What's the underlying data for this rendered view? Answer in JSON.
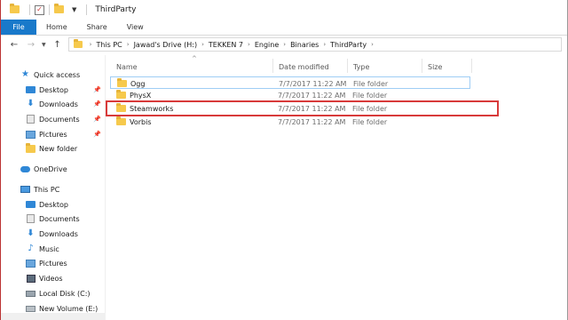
{
  "window": {
    "title": "ThirdParty"
  },
  "ribbon": {
    "tabs": [
      "File",
      "Home",
      "Share",
      "View"
    ]
  },
  "address": {
    "crumbs": [
      "This PC",
      "Jawad's Drive (H:)",
      "TEKKEN 7",
      "Engine",
      "Binaries",
      "ThirdParty"
    ]
  },
  "columns": {
    "name": "Name",
    "date": "Date modified",
    "type": "Type",
    "size": "Size"
  },
  "files": [
    {
      "name": "Ogg",
      "date": "7/7/2017 11:22 AM",
      "type": "File folder",
      "size": ""
    },
    {
      "name": "PhysX",
      "date": "7/7/2017 11:22 AM",
      "type": "File folder",
      "size": ""
    },
    {
      "name": "Steamworks",
      "date": "7/7/2017 11:22 AM",
      "type": "File folder",
      "size": ""
    },
    {
      "name": "Vorbis",
      "date": "7/7/2017 11:22 AM",
      "type": "File folder",
      "size": ""
    }
  ],
  "nav": {
    "quick_access": "Quick access",
    "quick_items": [
      "Desktop",
      "Downloads",
      "Documents",
      "Pictures",
      "New folder"
    ],
    "onedrive": "OneDrive",
    "this_pc": "This PC",
    "pc_items": [
      "Desktop",
      "Documents",
      "Downloads",
      "Music",
      "Pictures",
      "Videos",
      "Local Disk (C:)",
      "New Volume (E:)"
    ]
  },
  "colors": {
    "accent": "#1979ca",
    "highlight_box": "#d83a3a",
    "folder": "#f6c94c"
  }
}
